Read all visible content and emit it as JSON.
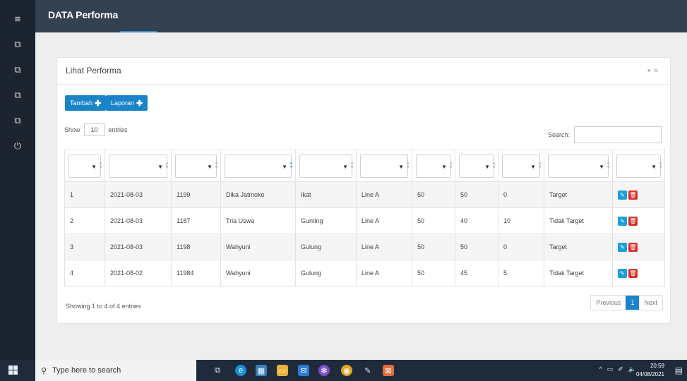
{
  "app": {
    "title": "DATA Performa"
  },
  "sidebar": {
    "items": [
      {
        "icon": "menu-icon",
        "glyph": "≡"
      },
      {
        "icon": "copy-icon",
        "glyph": "⧉"
      },
      {
        "icon": "copy-icon",
        "glyph": "⧉"
      },
      {
        "icon": "copy-icon",
        "glyph": "⧉"
      },
      {
        "icon": "copy-icon",
        "glyph": "⧉"
      },
      {
        "icon": "power-icon",
        "glyph": "⏻"
      }
    ]
  },
  "panel": {
    "title": "Lihat Performa",
    "buttons": {
      "add": "Tambah",
      "report": "Laporan"
    },
    "length": {
      "show": "Show",
      "value": "10",
      "entries": "entries"
    },
    "search": {
      "label": "Search:",
      "value": ""
    }
  },
  "table": {
    "rows": [
      [
        "1",
        "2021-08-03",
        "1199",
        "Dika Jatmoko",
        "Ikat",
        "Line A",
        "50",
        "50",
        "0",
        "Target"
      ],
      [
        "2",
        "2021-08-03",
        "1187",
        "Tria Uswa",
        "Gunting",
        "Line A",
        "50",
        "40",
        "10",
        "Tidak Target"
      ],
      [
        "3",
        "2021-08-03",
        "1198",
        "Wahyuni",
        "Gulung",
        "Line A",
        "50",
        "50",
        "0",
        "Target"
      ],
      [
        "4",
        "2021-08-02",
        "11984",
        "Wahyuni",
        "Gulung",
        "Line A",
        "50",
        "45",
        "5",
        "Tidak Target"
      ]
    ],
    "info": "Showing 1 to 4 of 4 entries",
    "pagination": {
      "previous": "Previous",
      "current": "1",
      "next": "Next"
    }
  },
  "taskbar": {
    "search_placeholder": "Type here to search",
    "time": "20:59",
    "date": "04/08/2021"
  },
  "colors": {
    "accent": "#1b84c9",
    "sidebar": "#1c2430",
    "topbar": "#344150",
    "edit": "#1aa0d8",
    "delete": "#d9322e"
  }
}
